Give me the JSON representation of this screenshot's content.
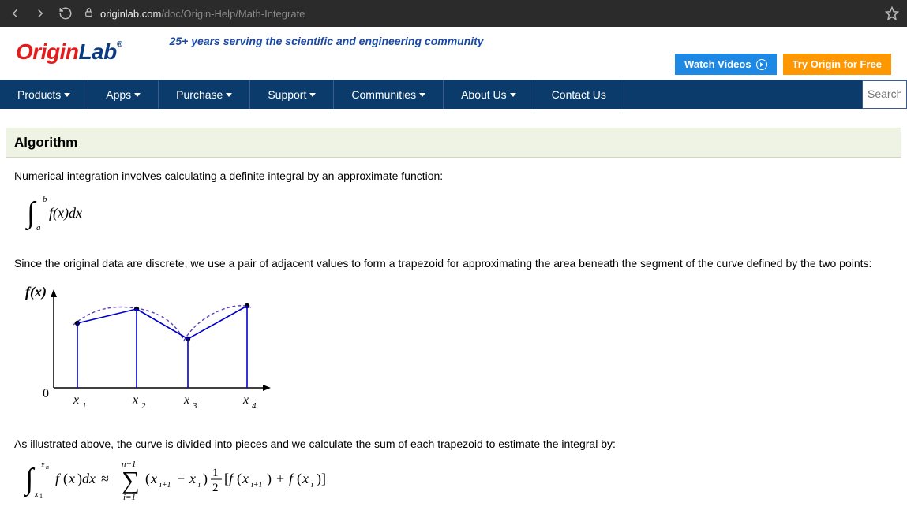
{
  "browser": {
    "url_domain": "originlab.com",
    "url_path": "/doc/Origin-Help/Math-Integrate"
  },
  "header": {
    "logo_part1": "Origin",
    "logo_part2": "Lab",
    "tagline": "25+ years serving the scientific and engineering community",
    "watch_btn": "Watch Videos",
    "try_btn": "Try Origin for Free"
  },
  "nav": {
    "items": [
      "Products",
      "Apps",
      "Purchase",
      "Support",
      "Communities",
      "About Us",
      "Contact Us"
    ],
    "search_placeholder": "Search"
  },
  "content": {
    "section_title": "Algorithm",
    "p1": "Numerical integration involves calculating a definite integral by an approximate function:",
    "p2": "Since the original data are discrete, we use a pair of adjacent values to form a trapezoid for approximating the area beneath the segment of the curve defined by the two points:",
    "p3": "As illustrated above, the curve is divided into pieces and we calculate the sum of each trapezoid to estimate the integral by:"
  },
  "figure": {
    "y_label": "f(x)",
    "origin": "0",
    "x_ticks": [
      "x",
      "x",
      "x",
      "x"
    ],
    "x_subs": [
      "1",
      "2",
      "3",
      "4"
    ]
  },
  "formula1": {
    "a": "a",
    "b": "b",
    "body": "f(x)dx"
  },
  "formula2": {
    "lower": "x1",
    "upper": "xn",
    "sum_upper": "n−1",
    "sum_lower": "i=1",
    "body_pre": "f(x)dx ≈",
    "term1": "(x",
    "sub_i1": "i+1",
    "minus": " − x",
    "sub_i2": "i",
    "close1": ")",
    "half_num": "1",
    "half_den": "2",
    "bracket_open": "[f(x",
    "sub_i3": "i+1",
    "mid": ") + f(x",
    "sub_i4": "i",
    "bracket_close": ")]"
  }
}
